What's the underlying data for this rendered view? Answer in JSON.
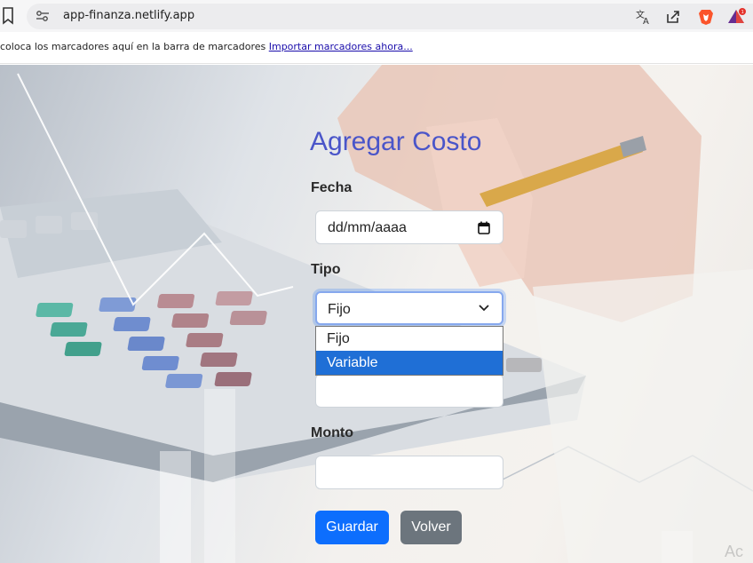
{
  "browser": {
    "url": "app-finanza.netlify.app",
    "bookmarks_prompt": "coloca los marcadores aquí en la barra de marcadores",
    "bookmarks_link": "Importar marcadores ahora..."
  },
  "form": {
    "title": "Agregar Costo",
    "fecha_label": "Fecha",
    "fecha_placeholder": "dd/mm/aaaa",
    "tipo_label": "Tipo",
    "tipo_value": "Fijo",
    "tipo_options": [
      "Fijo",
      "Variable"
    ],
    "monto_label": "Monto",
    "monto_value": "",
    "save_label": "Guardar",
    "back_label": "Volver"
  },
  "watermark": "Ac"
}
